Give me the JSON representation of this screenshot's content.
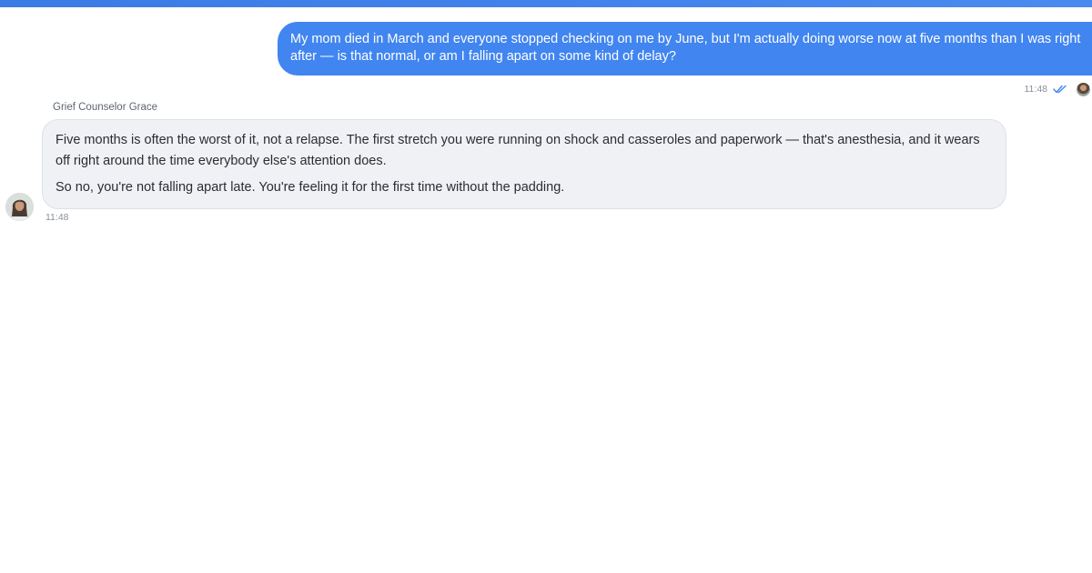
{
  "messages": {
    "outgoing": {
      "text": "My mom died in March and everyone stopped checking on me by June, but I'm actually doing worse now at five months than I was right after — is that normal, or am I falling apart on some kind of delay?",
      "time": "11:48",
      "status_icon": "double-check-icon",
      "accent_color": "#4185f0"
    },
    "incoming": {
      "sender": "Grief Counselor Grace",
      "paragraphs": [
        "Five months is often the worst of it, not a relapse. The first stretch you were running on shock and casseroles and paperwork — that's anesthesia, and it wears off right around the time everybody else's attention does.",
        "So no, you're not falling apart late. You're feeling it for the first time without the padding."
      ],
      "time": "11:48",
      "bubble_color": "#eff1f5"
    }
  },
  "colors": {
    "top_bar": "#3a7be6"
  }
}
